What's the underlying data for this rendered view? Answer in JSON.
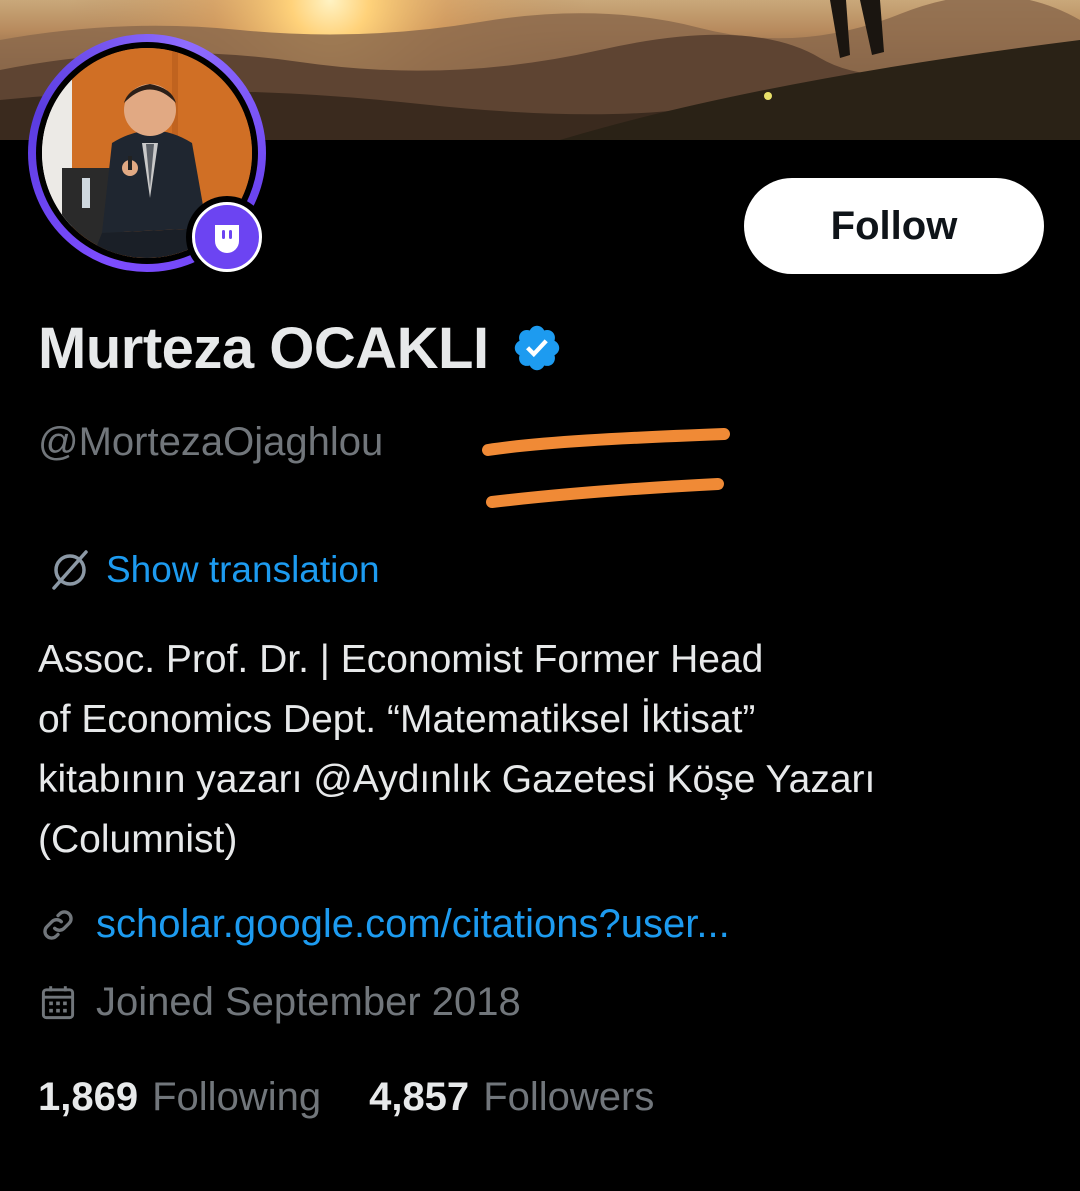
{
  "profile": {
    "display_name": "Murteza OCAKLI",
    "handle": "@MortezaOjaghlou",
    "verified": true,
    "follow_label": "Follow",
    "translate_label": "Show translation",
    "bio": "Assoc. Prof. Dr. | Economist   Former Head\nof Economics Dept. “Matematiksel İktisat”\nkitabının yazarı  @Aydınlık  Gazetesi Köşe Yazarı\n(Columnist)",
    "website": "scholar.google.com/citations?user...",
    "joined": "Joined September 2018",
    "following_count": "1,869",
    "following_label": "Following",
    "followers_count": "4,857",
    "followers_label": "Followers"
  },
  "icons": {
    "badge": "verified-check-icon",
    "spaces": "spaces-host-icon",
    "translate": "translate-globe-icon",
    "link": "link-icon",
    "calendar": "calendar-icon"
  },
  "colors": {
    "background": "#000000",
    "accent_blue": "#1d9bf0",
    "muted": "#71767b",
    "text": "#e7e9ea",
    "spaces_purple": "#6c44f2",
    "scribble_orange": "#f08a36"
  }
}
